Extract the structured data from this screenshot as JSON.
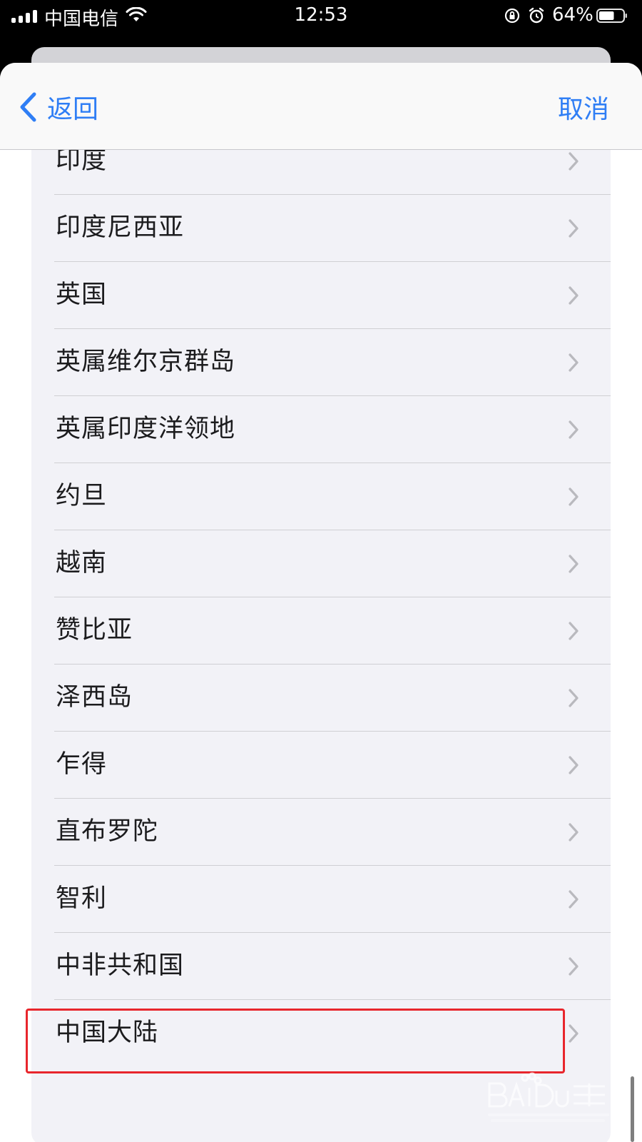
{
  "status_bar": {
    "carrier": "中国电信",
    "time": "12:53",
    "battery_percent": "64%",
    "battery_level": 0.64
  },
  "nav": {
    "back_label": "返回",
    "cancel_label": "取消",
    "accent_color": "#2f7ef5"
  },
  "regions": [
    {
      "label": "印度"
    },
    {
      "label": "印度尼西亚"
    },
    {
      "label": "英国"
    },
    {
      "label": "英属维尔京群岛"
    },
    {
      "label": "英属印度洋领地"
    },
    {
      "label": "约旦"
    },
    {
      "label": "越南"
    },
    {
      "label": "赞比亚"
    },
    {
      "label": "泽西岛"
    },
    {
      "label": "乍得"
    },
    {
      "label": "直布罗陀"
    },
    {
      "label": "智利"
    },
    {
      "label": "中非共和国"
    },
    {
      "label": "中国大陆"
    }
  ],
  "highlight_color": "#e8262c",
  "watermark": {
    "brand": "Baidu经验",
    "url": "jingyan.baidu.com"
  }
}
